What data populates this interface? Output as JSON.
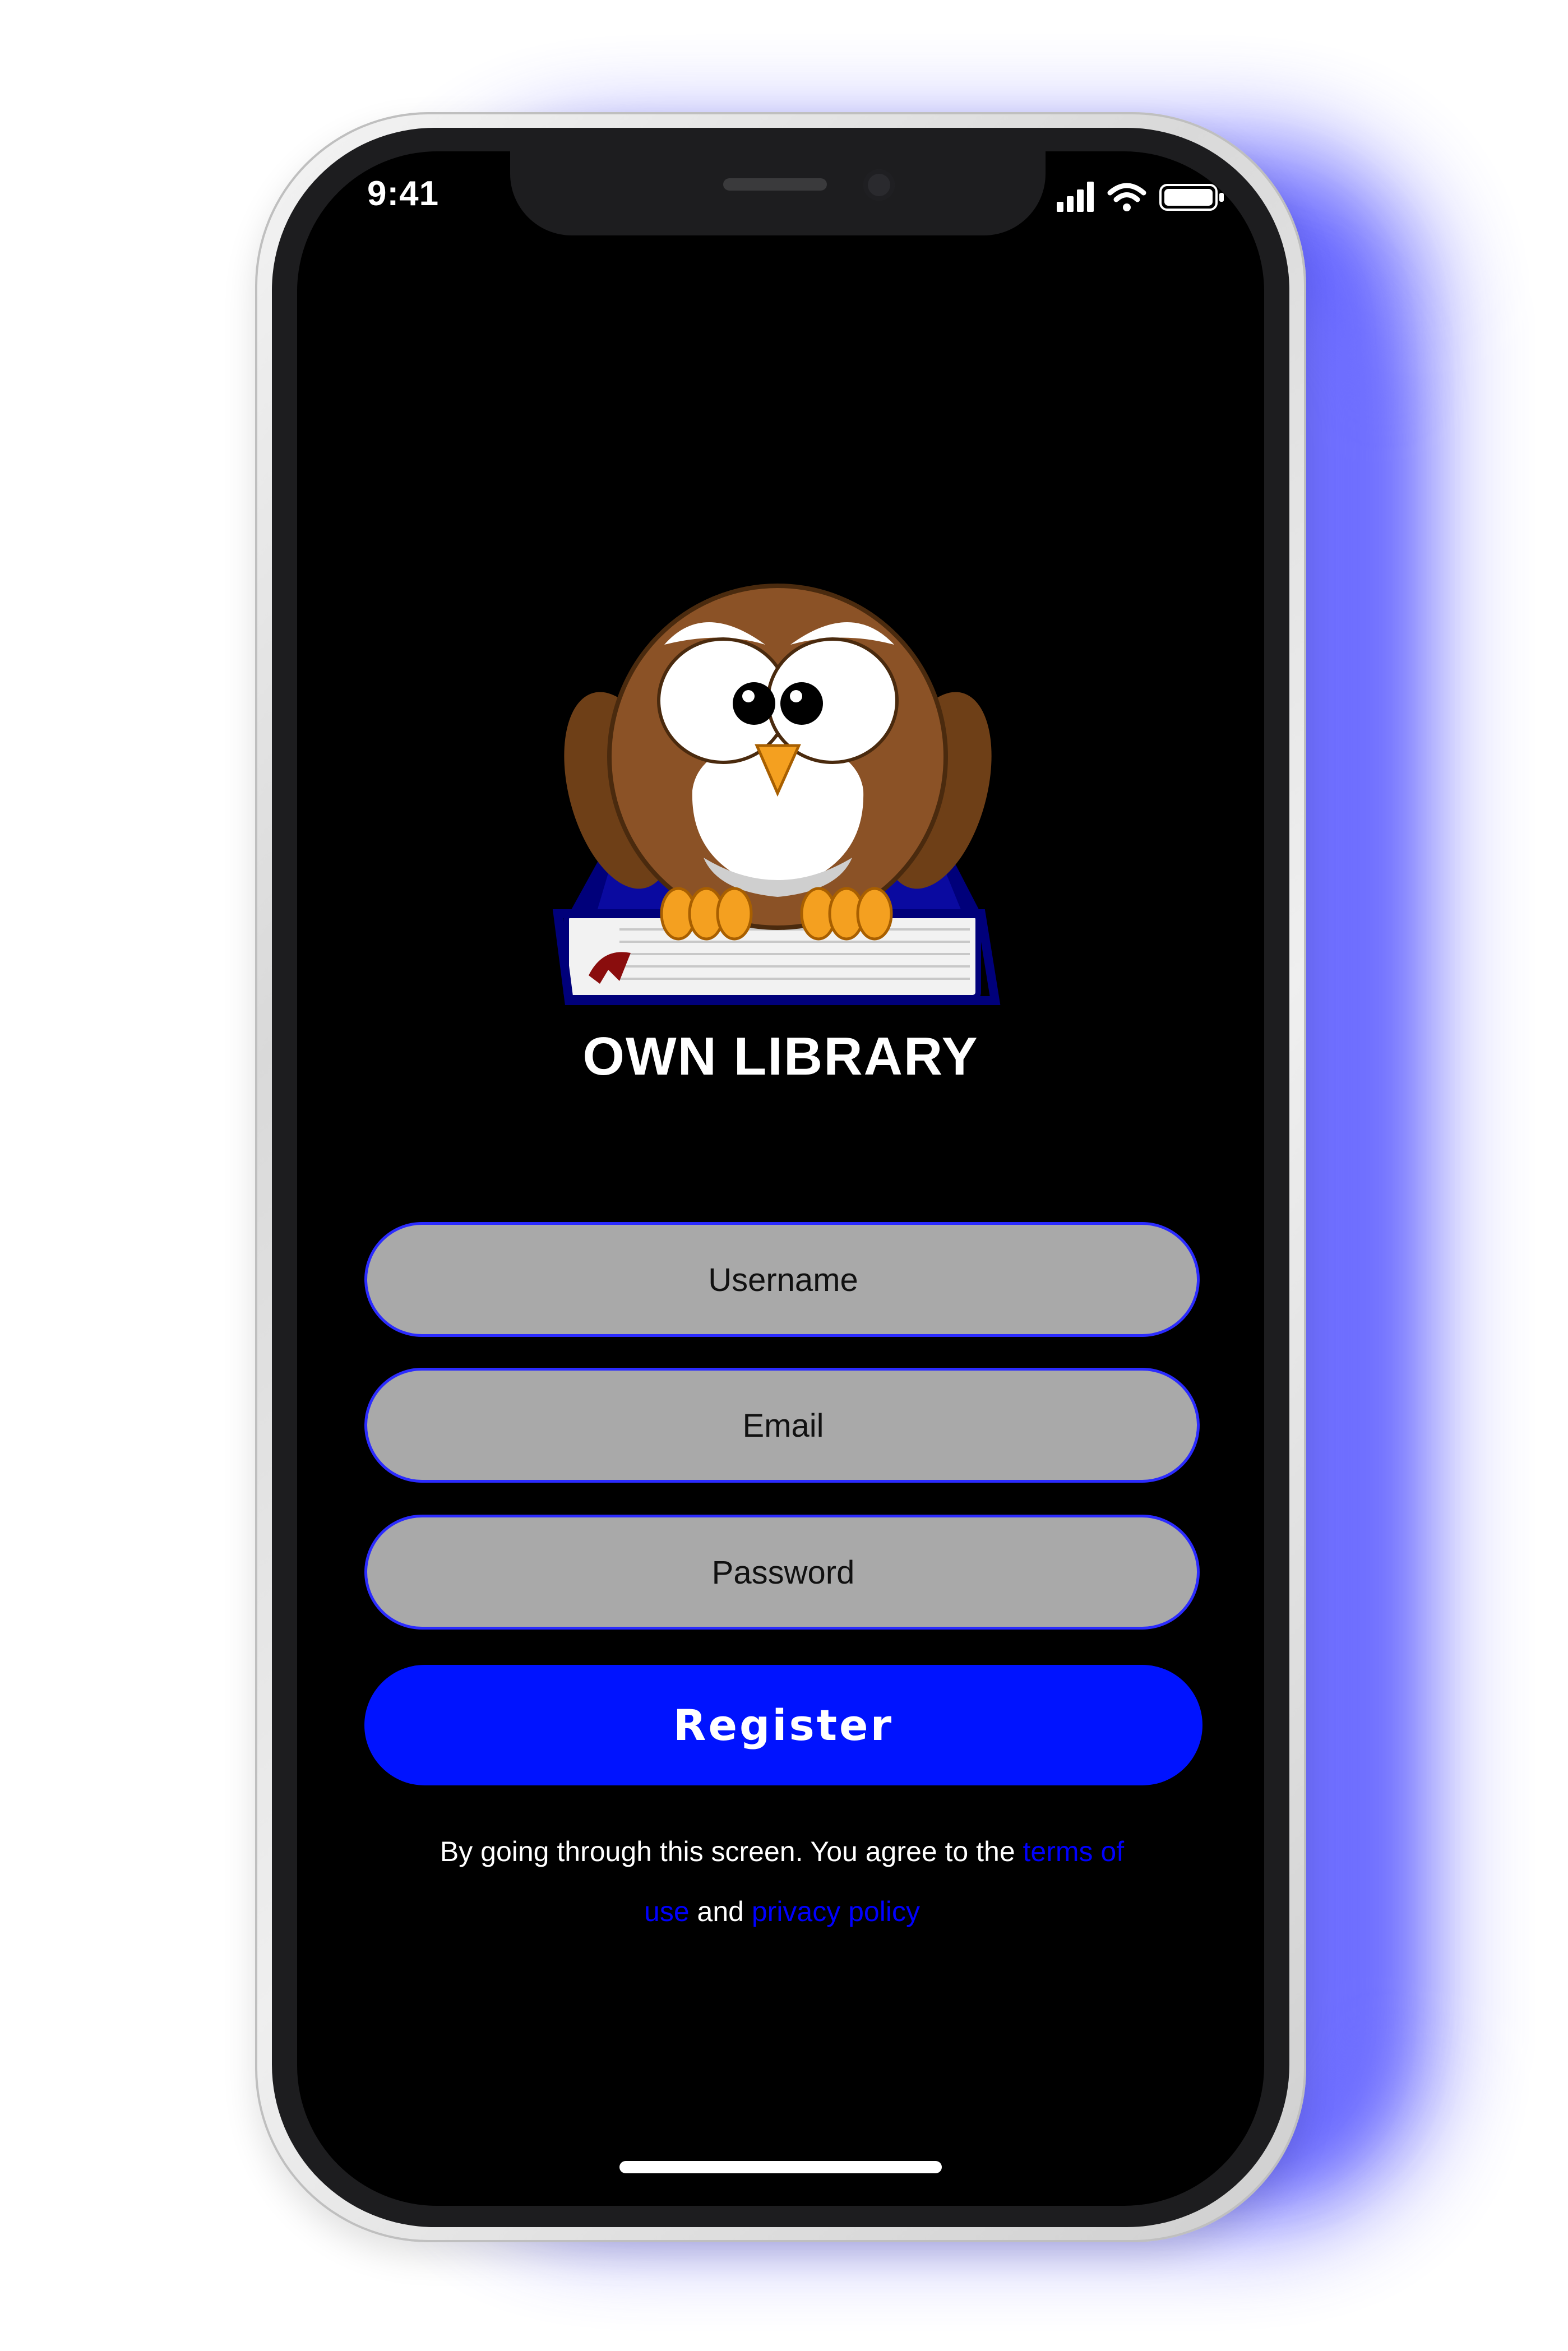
{
  "status_bar": {
    "time": "9:41"
  },
  "app": {
    "title": "OWN LIBRARY",
    "logo_icon": "owl-on-book-icon"
  },
  "form": {
    "username_placeholder": "Username",
    "email_placeholder": "Email",
    "password_placeholder": "Password",
    "register_label": "Register"
  },
  "legal": {
    "prefix": "By going through this screen. You agree to the ",
    "terms_link": "terms of use",
    "conjunction": " and ",
    "privacy_link": "privacy policy"
  },
  "colors": {
    "accent": "#0013ff",
    "input_background": "#a9a9a9",
    "input_border": "#2b2bff",
    "link": "#0000ff",
    "screen_background": "#000000"
  }
}
